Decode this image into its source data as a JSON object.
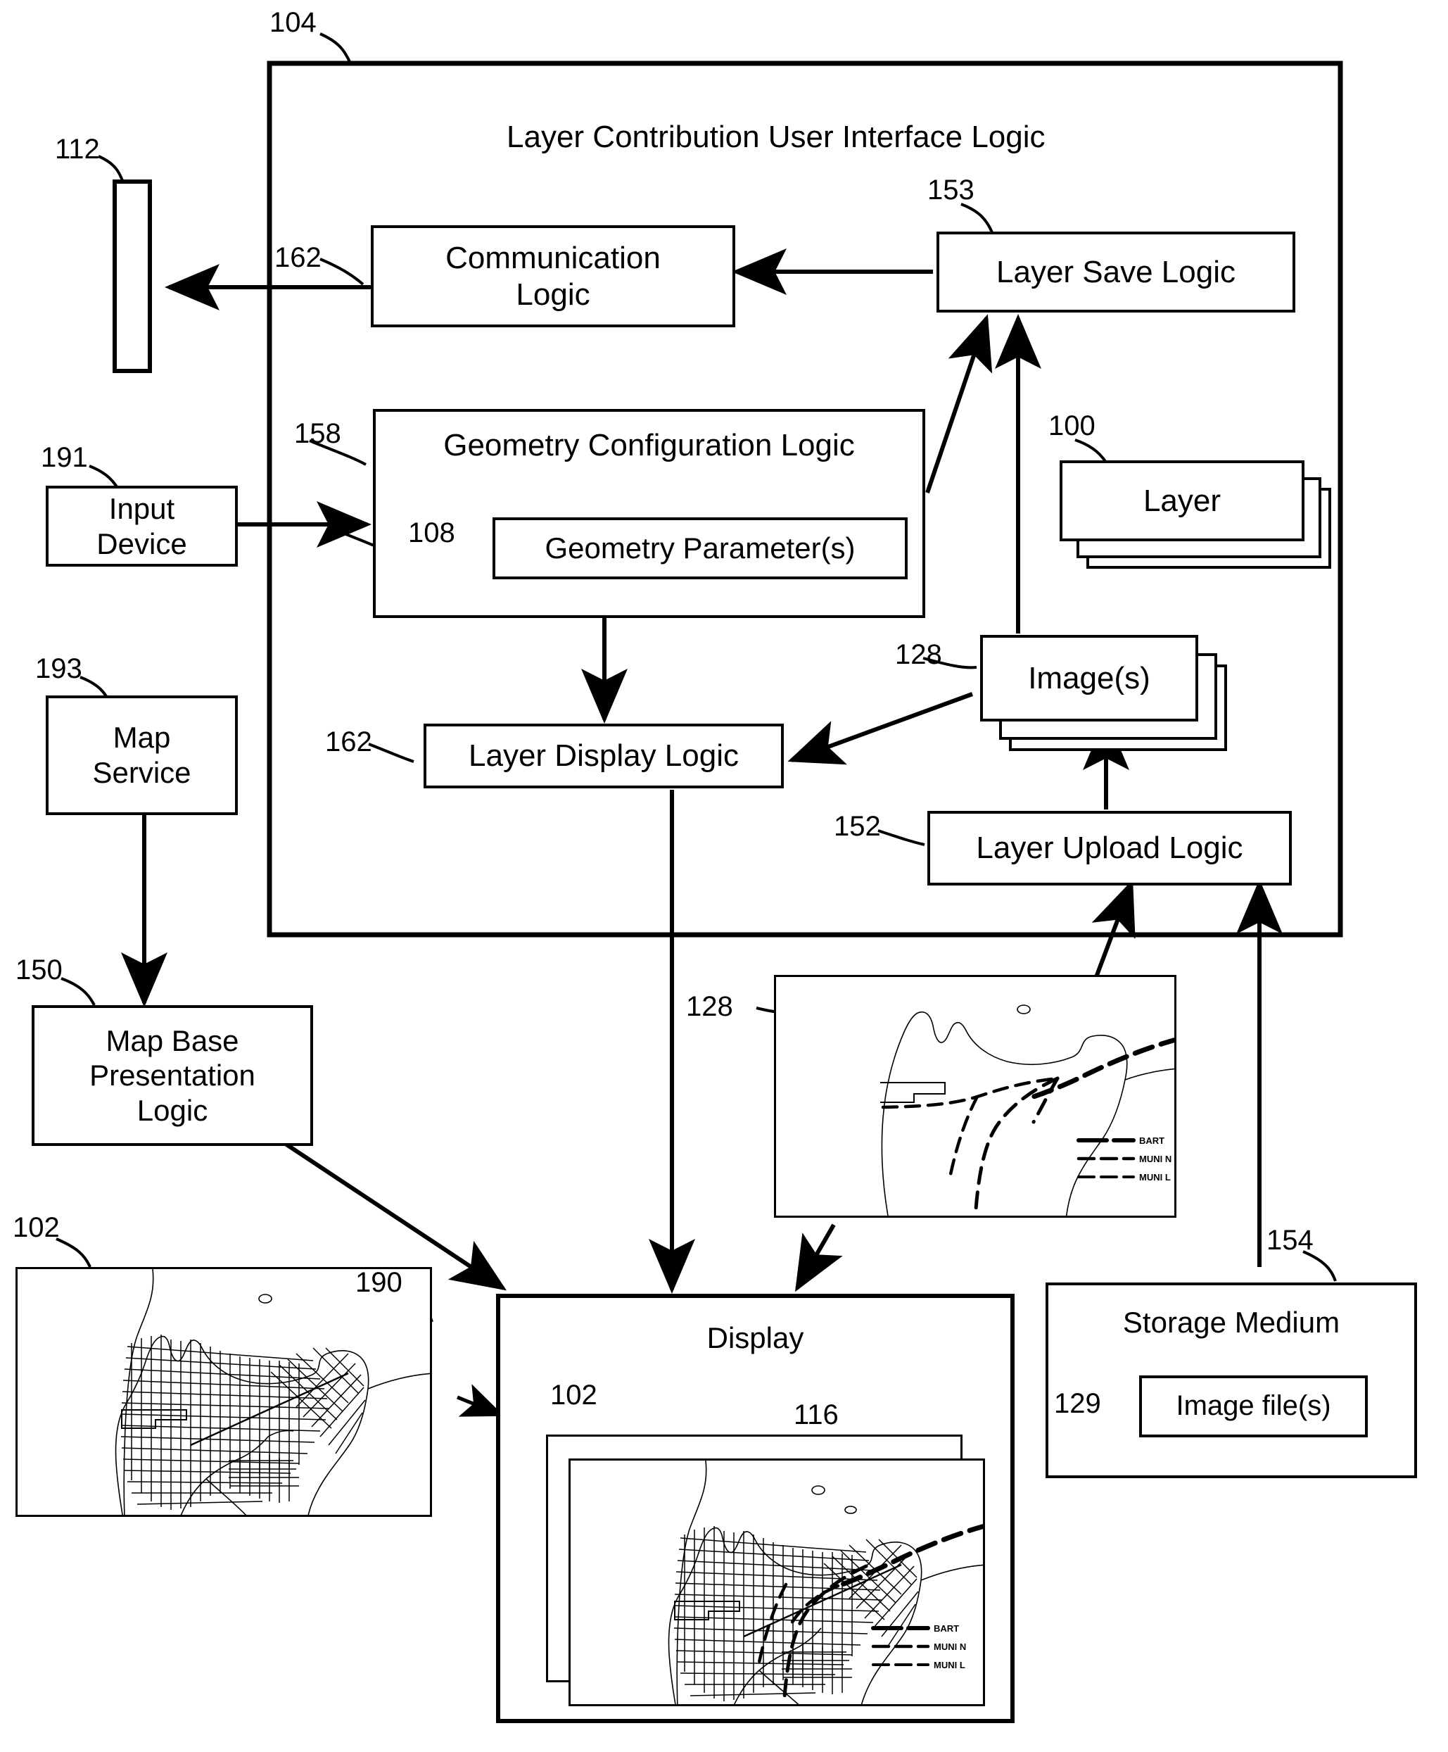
{
  "figure": {
    "container": {
      "ref": "104",
      "title": "Layer Contribution User Interface Logic"
    },
    "blocks": [
      {
        "id": "network",
        "ref": "112",
        "label": ""
      },
      {
        "id": "communication-logic",
        "ref": "162",
        "label": "Communication\nLogic",
        "line1": "Communication",
        "line2": "Logic"
      },
      {
        "id": "layer-save-logic",
        "ref": "153",
        "label": "Layer Save Logic"
      },
      {
        "id": "layer-stack",
        "ref": "100",
        "label": "Layer"
      },
      {
        "id": "input-device",
        "ref": "191",
        "line1": "Input",
        "line2": "Device"
      },
      {
        "id": "geometry-configuration-logic",
        "ref": "158",
        "label": "Geometry Configuration Logic"
      },
      {
        "id": "geometry-parameters",
        "ref": "108",
        "label": "Geometry Parameter(s)"
      },
      {
        "id": "image-stack",
        "ref": "128",
        "label": "Image(s)"
      },
      {
        "id": "map-service",
        "ref": "193",
        "line1": "Map",
        "line2": "Service"
      },
      {
        "id": "layer-display-logic",
        "ref": "162",
        "label": "Layer Display Logic"
      },
      {
        "id": "layer-upload-logic",
        "ref": "152",
        "label": "Layer Upload Logic"
      },
      {
        "id": "map-base-presentation-logic",
        "ref": "150",
        "line1": "Map Base",
        "line2": "Presentation",
        "line3": "Logic"
      },
      {
        "id": "base-map-image",
        "ref": "102",
        "label": ""
      },
      {
        "id": "transit-layer-image",
        "ref": "128",
        "label": ""
      },
      {
        "id": "display",
        "ref": "190",
        "label": "Display"
      },
      {
        "id": "display-base-map",
        "ref": "102",
        "label": ""
      },
      {
        "id": "display-composite",
        "ref": "116",
        "label": ""
      },
      {
        "id": "storage-medium",
        "ref": "154",
        "label": "Storage Medium"
      },
      {
        "id": "image-files",
        "ref": "129",
        "label": "Image file(s)"
      }
    ],
    "map_legend": {
      "entries": [
        {
          "name": "BART",
          "style": "heavy-dash"
        },
        {
          "name": "MUNI N",
          "style": "medium-dash"
        },
        {
          "name": "MUNI L",
          "style": "light-dash"
        }
      ]
    }
  },
  "refs": {
    "r104": "104",
    "r112": "112",
    "r162a": "162",
    "r153": "153",
    "r100": "100",
    "r191": "191",
    "r158": "158",
    "r108": "108",
    "r128a": "128",
    "r193": "193",
    "r162b": "162",
    "r152": "152",
    "r150": "150",
    "r102a": "102",
    "r128b": "128",
    "r190": "190",
    "r102b": "102",
    "r116": "116",
    "r154": "154",
    "r129": "129"
  },
  "text": {
    "container_title": "Layer Contribution User Interface Logic",
    "communication_l1": "Communication",
    "communication_l2": "Logic",
    "layer_save_logic": "Layer Save Logic",
    "layer": "Layer",
    "input_l1": "Input",
    "input_l2": "Device",
    "geometry_config": "Geometry Configuration Logic",
    "geometry_params": "Geometry Parameter(s)",
    "images": "Image(s)",
    "map_l1": "Map",
    "map_l2": "Service",
    "layer_display_logic": "Layer Display Logic",
    "layer_upload_logic": "Layer Upload Logic",
    "mapbase_l1": "Map Base",
    "mapbase_l2": "Presentation",
    "mapbase_l3": "Logic",
    "display": "Display",
    "storage_medium": "Storage Medium",
    "image_files": "Image file(s)",
    "legend_bart": "BART",
    "legend_muni_n": "MUNI N",
    "legend_muni_l": "MUNI L",
    "legend_bart_2": "BART",
    "legend_muni_n_2": "MUNI N",
    "legend_muni_l_2": "MUNI L",
    "legend_bart_3": "BART",
    "legend_muni_n_3": "MUNI N",
    "legend_muni_l_3": "MUNI L"
  },
  "colors": {
    "ink": "#000000",
    "paper": "#ffffff"
  }
}
